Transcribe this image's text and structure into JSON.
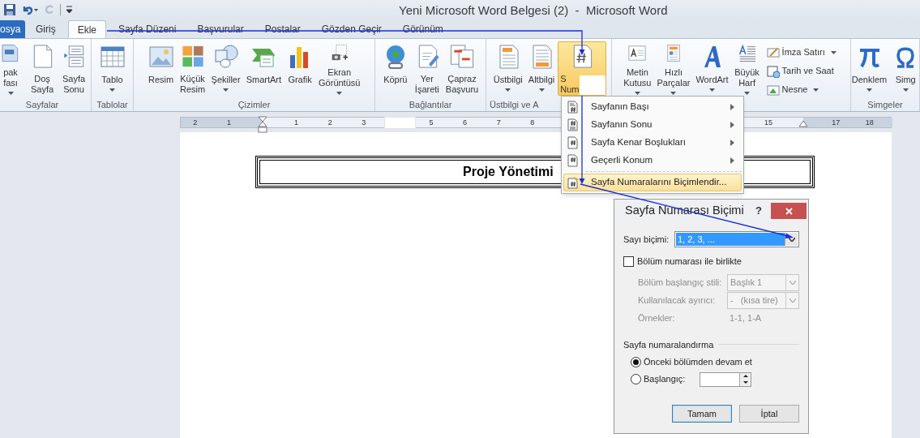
{
  "window": {
    "title": "Yeni Microsoft Word Belgesi (2)  -  Microsoft Word"
  },
  "tabs": [
    {
      "label": "osya",
      "kind": "file",
      "selected": false
    },
    {
      "label": "Giriş",
      "kind": "tab",
      "selected": false
    },
    {
      "label": "Ekle",
      "kind": "tab",
      "selected": true
    },
    {
      "label": "Sayfa Düzeni",
      "kind": "tab",
      "selected": false
    },
    {
      "label": "Başvurular",
      "kind": "tab",
      "selected": false
    },
    {
      "label": "Postalar",
      "kind": "tab",
      "selected": false
    },
    {
      "label": "Gözden Geçir",
      "kind": "tab",
      "selected": false
    },
    {
      "label": "Görünüm",
      "kind": "tab",
      "selected": false
    }
  ],
  "ribbon": {
    "groups": [
      {
        "label": "Sayfalar",
        "buttons": [
          {
            "label": "pak\nfası",
            "dropdown": true,
            "selected": false
          },
          {
            "label": "Doş\nSayfa",
            "dropdown": false,
            "selected": false
          },
          {
            "label": "Sayfa\nSonu",
            "dropdown": false,
            "selected": false
          }
        ]
      },
      {
        "label": "Tablolar",
        "buttons": [
          {
            "label": "Tablo",
            "dropdown": true,
            "selected": false
          }
        ]
      },
      {
        "label": "Çizimler",
        "buttons": [
          {
            "label": "Resim",
            "dropdown": false,
            "selected": false
          },
          {
            "label": "Küçük\nResim",
            "dropdown": false,
            "selected": false
          },
          {
            "label": "Şekiller",
            "dropdown": true,
            "selected": false
          },
          {
            "label": "SmartArt",
            "dropdown": false,
            "selected": false
          },
          {
            "label": "Grafik",
            "dropdown": false,
            "selected": false
          },
          {
            "label": "Ekran\nGörüntüsü",
            "dropdown": true,
            "selected": false
          }
        ]
      },
      {
        "label": "Bağlantılar",
        "buttons": [
          {
            "label": "Köprü",
            "dropdown": false,
            "selected": false
          },
          {
            "label": "Yer\nİşareti",
            "dropdown": false,
            "selected": false
          },
          {
            "label": "Çapraz\nBaşvuru",
            "dropdown": false,
            "selected": false
          }
        ]
      },
      {
        "label": "Üstbilgi ve A",
        "buttons": [
          {
            "label": "Üstbilgi",
            "dropdown": true,
            "selected": false
          },
          {
            "label": "Altbilgi",
            "dropdown": true,
            "selected": false
          },
          {
            "label": "S\nNum",
            "dropdown": false,
            "selected": true
          }
        ]
      },
      {
        "buttons": [
          {
            "label": "Metin\nKutusu",
            "dropdown": true,
            "selected": false
          },
          {
            "label": "Hızlı\nParçalar",
            "dropdown": true,
            "selected": false
          },
          {
            "label": "WordArt",
            "dropdown": true,
            "selected": false
          },
          {
            "label": "Büyük\nHarf",
            "dropdown": true,
            "selected": false
          }
        ],
        "small_items": [
          {
            "label": "İmza Satırı",
            "dropdown": true
          },
          {
            "label": "Tarih ve Saat",
            "dropdown": false
          },
          {
            "label": "Nesne",
            "dropdown": true
          }
        ]
      },
      {
        "label": "Simgeler",
        "buttons": [
          {
            "label": "Denklem",
            "dropdown": true,
            "selected": false
          },
          {
            "label": "Simg",
            "dropdown": true,
            "selected": false
          }
        ]
      }
    ]
  },
  "ruler_numbers": [
    "2",
    "1",
    "1",
    "2",
    "3",
    "5",
    "6",
    "7",
    "8",
    "15",
    "17",
    "18"
  ],
  "document": {
    "heading": "Proje Yönetimi"
  },
  "menu": {
    "items": [
      {
        "label": "Sayfanın Başı",
        "submenu": true,
        "selected": false
      },
      {
        "label": "Sayfanın Sonu",
        "submenu": true,
        "selected": false
      },
      {
        "label": "Sayfa Kenar Boşlukları",
        "submenu": true,
        "selected": false
      },
      {
        "label": "Geçerli Konum",
        "submenu": true,
        "selected": false
      },
      {
        "label": "Sayfa Numaralarını Biçimlendir...",
        "submenu": false,
        "selected": true
      }
    ]
  },
  "dialog": {
    "title": "Sayfa Numarası Biçimi",
    "help": "?",
    "number_format": {
      "label": "Sayı biçimi:",
      "value": "1, 2, 3, ...",
      "selected": true
    },
    "include_chapter": {
      "label": "Bölüm numarası ile birlikte",
      "checked": false
    },
    "chapter_style": {
      "label": "Bölüm başlangıç stili:",
      "value": "Başlık 1",
      "disabled": true
    },
    "separator": {
      "label": "Kullanılacak ayırıcı:",
      "value": "-   (kısa tire)",
      "disabled": true
    },
    "examples": {
      "label": "Örnekler:",
      "value": "1-1, 1-A",
      "disabled": true
    },
    "numbering_section": "Sayfa numaralandırma",
    "radios": [
      {
        "label": "Önceki bölümden devam et",
        "selected": true
      },
      {
        "label": "Başlangıç:",
        "selected": false
      }
    ],
    "buttons": [
      {
        "label": "Tamam",
        "kind": "default"
      },
      {
        "label": "İptal",
        "kind": "normal"
      }
    ]
  }
}
